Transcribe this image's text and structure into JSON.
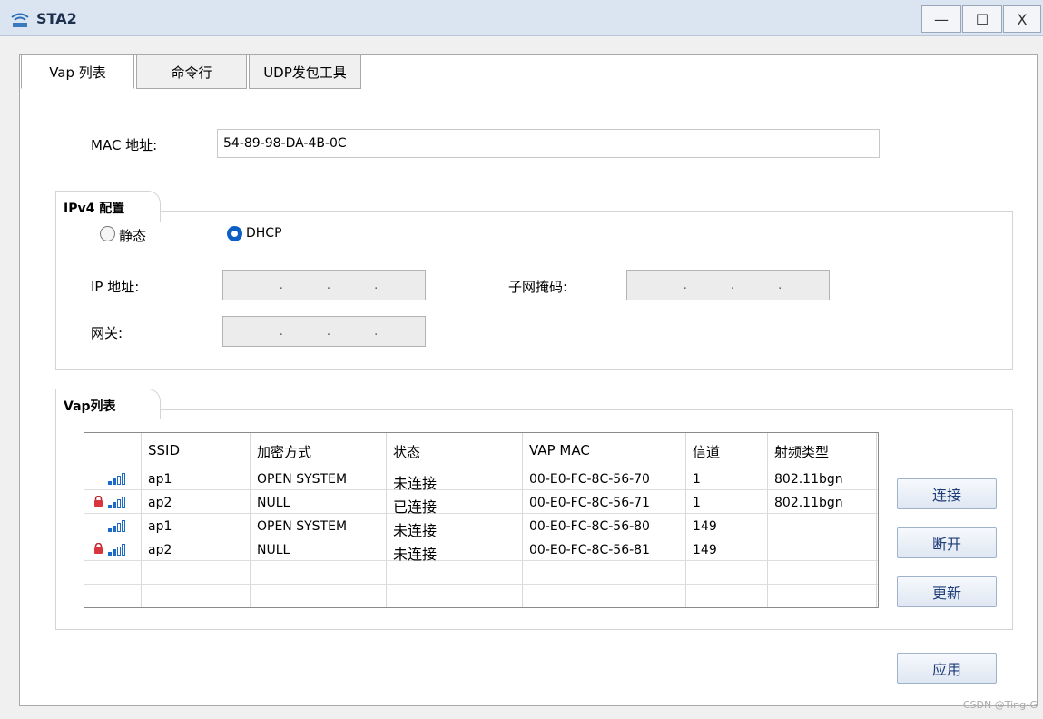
{
  "window": {
    "title": "STA2",
    "min_symbol": "—",
    "max_symbol": "☐",
    "close_symbol": "X"
  },
  "tabs": [
    {
      "label": "Vap 列表",
      "active": true
    },
    {
      "label": "命令行",
      "active": false
    },
    {
      "label": "UDP发包工具",
      "active": false
    }
  ],
  "mac": {
    "label": "MAC 地址:",
    "value": "54-89-98-DA-4B-0C"
  },
  "ipv4": {
    "group_title": "IPv4 配置",
    "static_label": "静态",
    "dhcp_label": "DHCP",
    "selected": "DHCP",
    "ip_label": "IP 地址:",
    "mask_label": "子网掩码:",
    "gateway_label": "网关:",
    "ip_dots": [
      ".",
      ".",
      "."
    ],
    "mask_dots": [
      ".",
      ".",
      "."
    ],
    "gateway_dots": [
      ".",
      ".",
      "."
    ]
  },
  "vap": {
    "group_title": "Vap列表",
    "headers": [
      "SSID",
      "加密方式",
      "状态",
      "VAP MAC",
      "信道",
      "射频类型"
    ],
    "rows": [
      {
        "locked": false,
        "signal": 2,
        "ssid": "ap1",
        "encryption": "OPEN SYSTEM",
        "status": "未连接",
        "mac": "00-E0-FC-8C-56-70",
        "channel": "1",
        "radio": "802.11bgn"
      },
      {
        "locked": true,
        "signal": 2,
        "ssid": "ap2",
        "encryption": "NULL",
        "status": "已连接",
        "mac": "00-E0-FC-8C-56-71",
        "channel": "1",
        "radio": "802.11bgn"
      },
      {
        "locked": false,
        "signal": 2,
        "ssid": "ap1",
        "encryption": "OPEN SYSTEM",
        "status": "未连接",
        "mac": "00-E0-FC-8C-56-80",
        "channel": "149",
        "radio": ""
      },
      {
        "locked": true,
        "signal": 2,
        "ssid": "ap2",
        "encryption": "NULL",
        "status": "未连接",
        "mac": "00-E0-FC-8C-56-81",
        "channel": "149",
        "radio": ""
      }
    ]
  },
  "buttons": {
    "connect": "连接",
    "disconnect": "断开",
    "refresh": "更新",
    "apply": "应用"
  },
  "watermark": "CSDN @Ting-G",
  "colors": {
    "accent": "#1b69c8",
    "titlebar": "#dbe4f1",
    "button_text": "#1e3c78"
  }
}
